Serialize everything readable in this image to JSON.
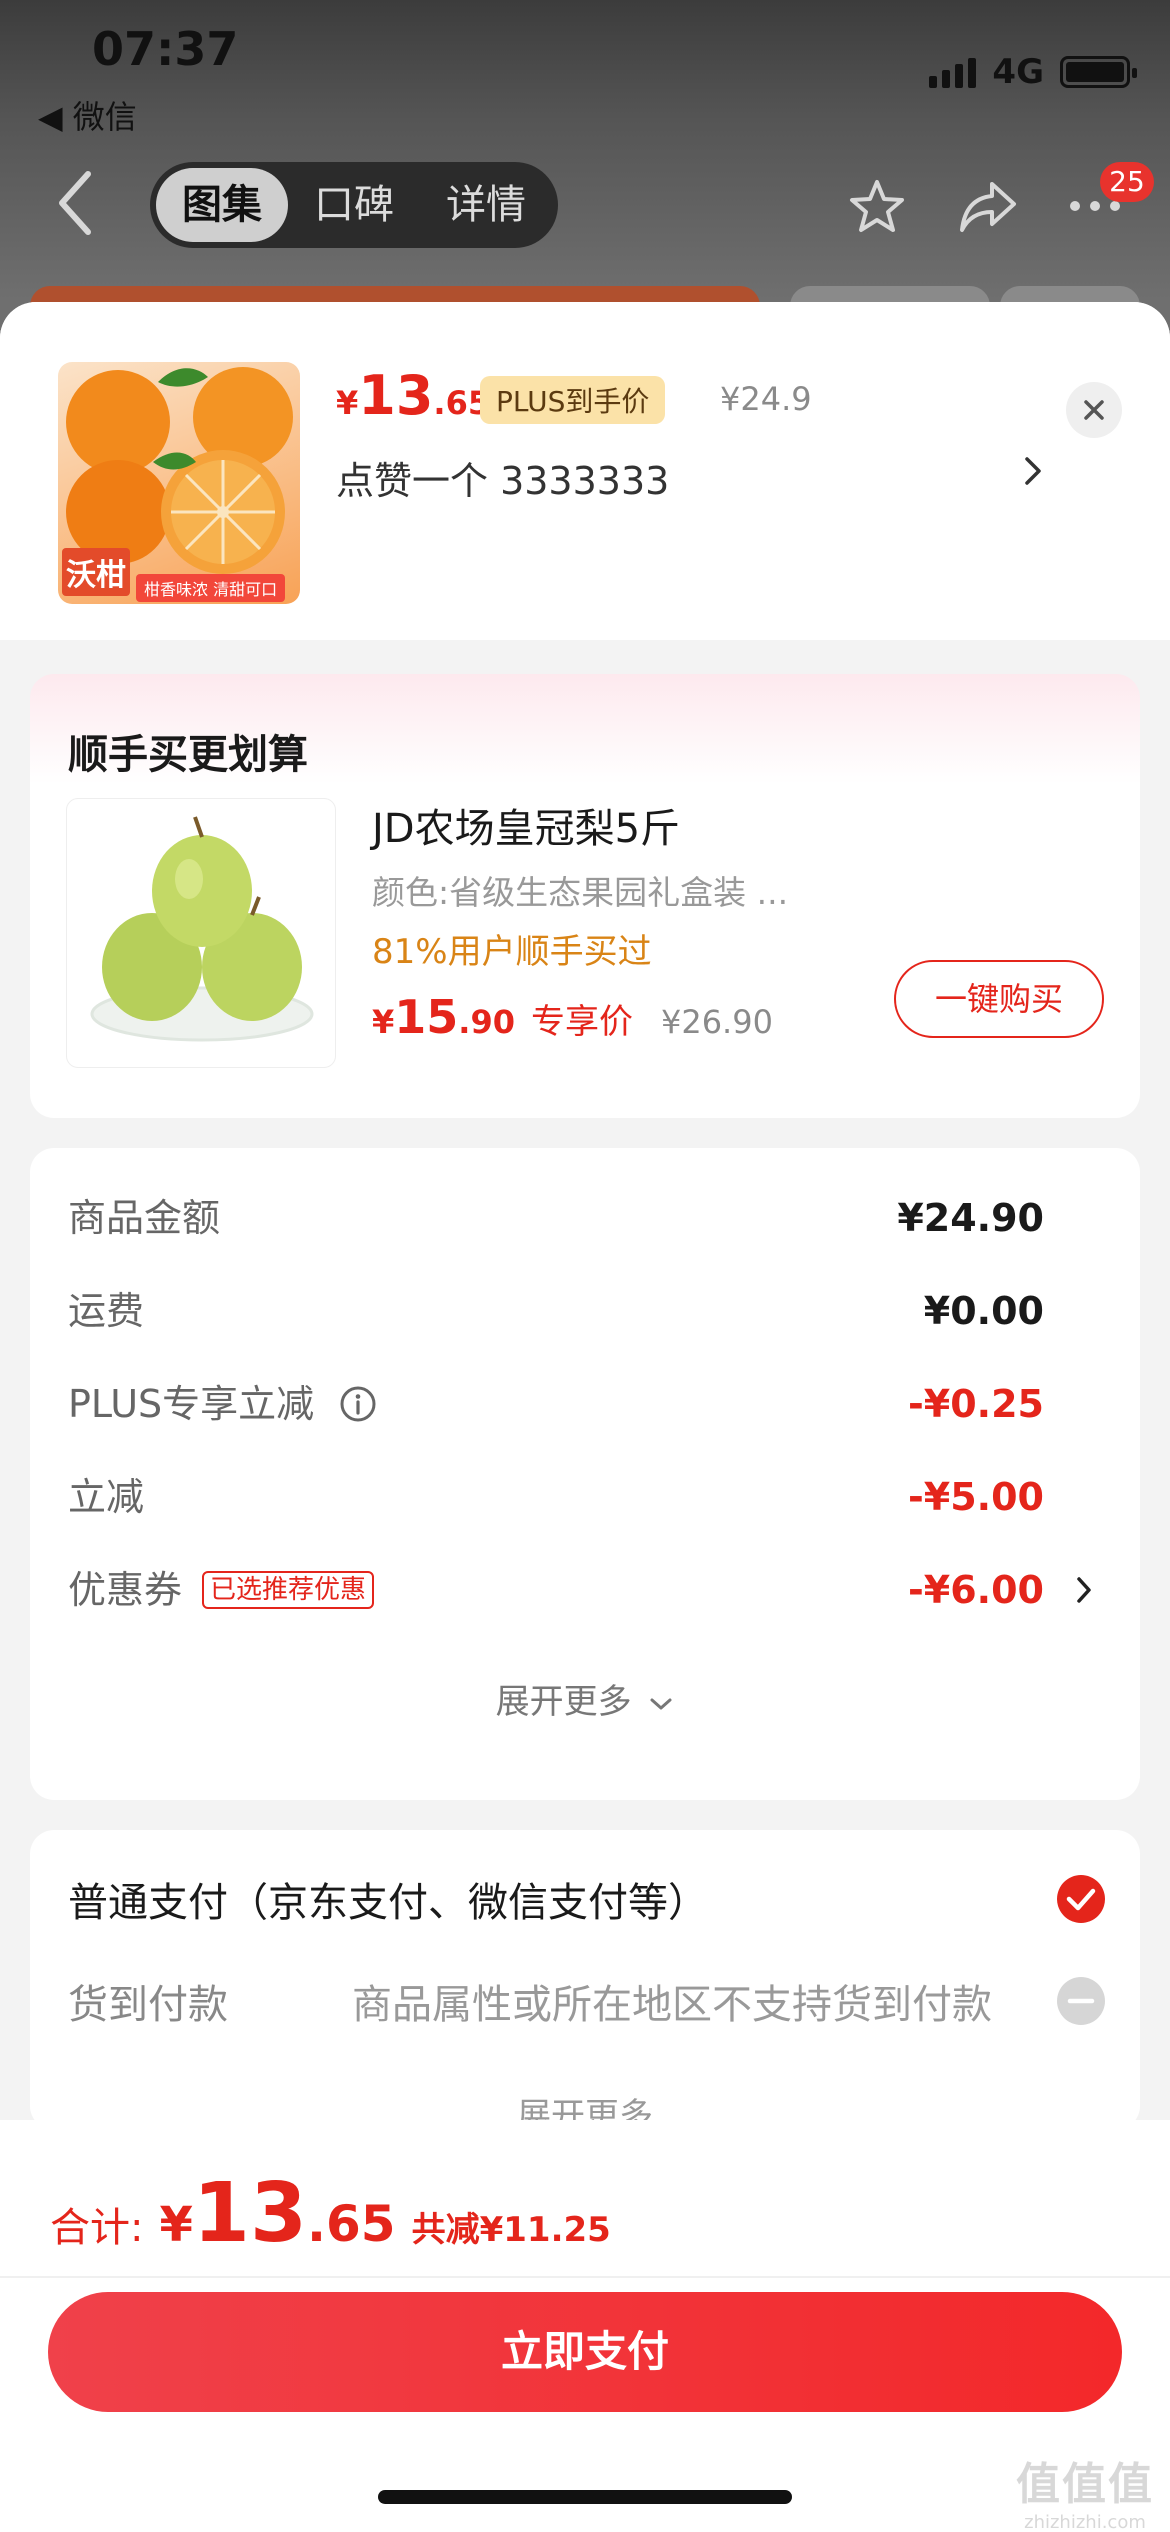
{
  "status_bar": {
    "time": "07:37",
    "back_app": "◀ 微信",
    "network": "4G"
  },
  "nav": {
    "tabs": [
      {
        "label": "图集",
        "active": true
      },
      {
        "label": "口碑",
        "active": false
      },
      {
        "label": "详情",
        "active": false
      }
    ],
    "badge_count": "25",
    "icons": [
      "back-arrow-icon",
      "star-icon",
      "share-icon",
      "more-icon"
    ]
  },
  "product": {
    "image_brand": "沃柑",
    "image_tag": "柑香味浓 清甜可口",
    "currency": "¥",
    "price_int": "13",
    "price_dec": ".65",
    "plus_label": "PLUS到手价",
    "original_price": "¥24.9",
    "spec": "点赞一个  3333333"
  },
  "upsell": {
    "title": "顺手买更划算",
    "name": "JD农场皇冠梨5斤",
    "spec": "颜色:省级生态果园礼盒装  ...",
    "buyers": "81%用户顺手买过",
    "currency": "¥",
    "price_int": "15",
    "price_dec": ".90",
    "exclusive_label": "专享价",
    "original_price": "¥26.90",
    "buy_label": "一键购买"
  },
  "summary": {
    "rows": [
      {
        "label": "商品金额",
        "value": "¥24.90",
        "highlight": false
      },
      {
        "label": "运费",
        "value": "¥0.00",
        "highlight": false
      },
      {
        "label": "PLUS专享立减",
        "value": "-¥0.25",
        "highlight": true
      },
      {
        "label": "立减",
        "value": "-¥5.00",
        "highlight": true
      },
      {
        "label": "优惠券",
        "value": "-¥6.00",
        "highlight": true,
        "tag": "已选推荐优惠"
      }
    ],
    "expand_label": "展开更多"
  },
  "payment": {
    "option1": "普通支付（京东支付、微信支付等）",
    "option2_label": "货到付款",
    "option2_note": "商品属性或所在地区不支持货到付款",
    "expand_label": "展开更多"
  },
  "footer": {
    "total_label": "合计:",
    "currency": "¥",
    "total_int": "13",
    "total_dec": ".65",
    "saved": "共减¥11.25",
    "pay_button": "立即支付"
  },
  "watermark": {
    "logo": "值值值",
    "url": "zhizhizhi.com"
  },
  "colors": {
    "accent_red": "#e4251b",
    "plus_gold": "#fbe2a8",
    "buyers_orange": "#d98416"
  }
}
